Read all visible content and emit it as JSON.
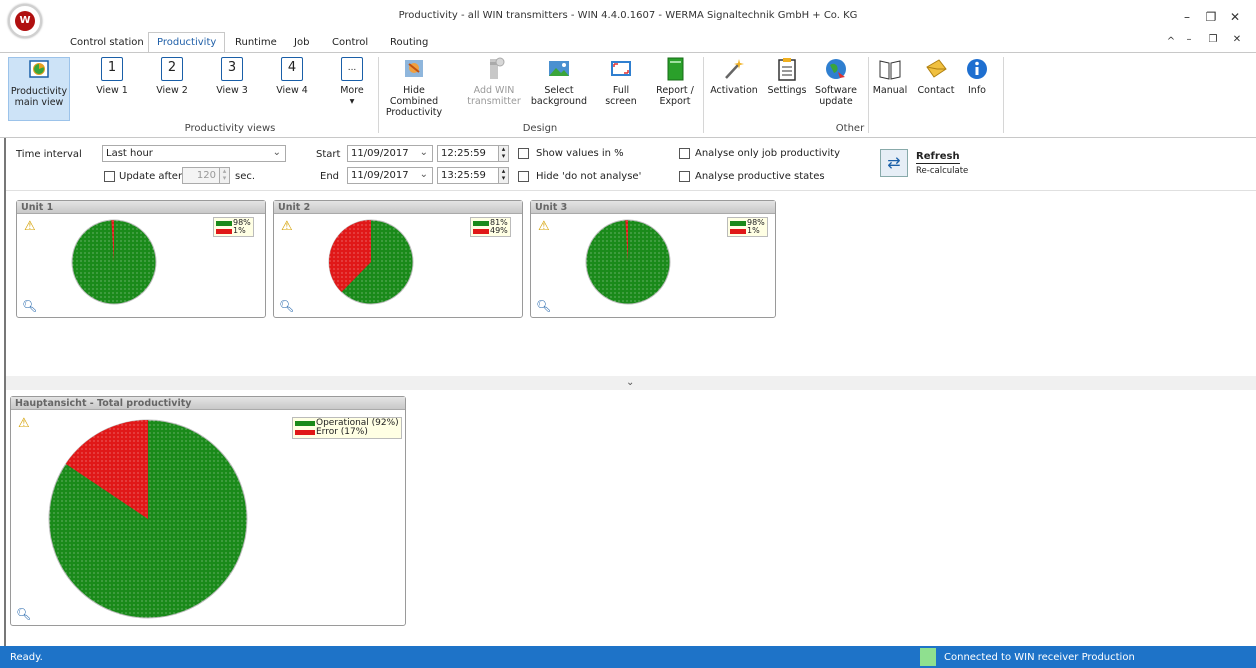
{
  "window": {
    "title": "Productivity - all WIN transmitters - WIN 4.4.0.1607 - WERMA Signaltechnik GmbH + Co. KG",
    "logo_text": "W"
  },
  "tabs": [
    "Control station",
    "Productivity",
    "Runtime",
    "Job",
    "Control",
    "Routing"
  ],
  "ribbon": {
    "main_view": "Productivity main view",
    "view1": "View 1",
    "view2": "View 2",
    "view3": "View 3",
    "view4": "View 4",
    "view1_num": "1",
    "view2_num": "2",
    "view3_num": "3",
    "view4_num": "4",
    "more": "More",
    "more_icon": "...",
    "group_views": "Productivity views",
    "hide_combined": "Hide Combined Productivity",
    "add_win": "Add WIN transmitter",
    "select_bg": "Select background",
    "full_screen": "Full screen",
    "report": "Report / Export",
    "group_design": "Design",
    "activation": "Activation",
    "settings": "Settings",
    "software_update": "Software update",
    "manual": "Manual",
    "contact": "Contact",
    "info": "Info",
    "group_other": "Other"
  },
  "filter": {
    "time_interval_label": "Time interval",
    "time_interval_value": "Last hour",
    "update_after_label": "Update after",
    "update_after_value": "120",
    "update_after_unit": "sec.",
    "start_label": "Start",
    "start_date": "11/09/2017",
    "start_time": "12:25:59",
    "end_label": "End",
    "end_date": "11/09/2017",
    "end_time": "13:25:59",
    "show_percent": "Show values in %",
    "hide_not_analyse": "Hide 'do not analyse'",
    "analyse_job": "Analyse only job productivity",
    "analyse_states": "Analyse productive states",
    "refresh": "Refresh",
    "recalculate": "Re-calculate"
  },
  "units": [
    {
      "name": "Unit 1",
      "op_label": "98%",
      "err_label": "1%",
      "op": 98,
      "err": 1
    },
    {
      "name": "Unit 2",
      "op_label": "81%",
      "err_label": "49%",
      "op": 81,
      "err": 49
    },
    {
      "name": "Unit 3",
      "op_label": "98%",
      "err_label": "1%",
      "op": 98,
      "err": 1
    }
  ],
  "total": {
    "title": "Hauptansicht - Total productivity",
    "op_legend": "Operational (92%)",
    "err_legend": "Error (17%)",
    "op": 92,
    "err": 17
  },
  "colors": {
    "operational": "#1a8a1a",
    "error": "#e01818",
    "status_bar": "#1e73c8",
    "connected": "#8fe08f"
  },
  "status": {
    "left": "Ready.",
    "right": "Connected to WIN receiver Production"
  }
}
